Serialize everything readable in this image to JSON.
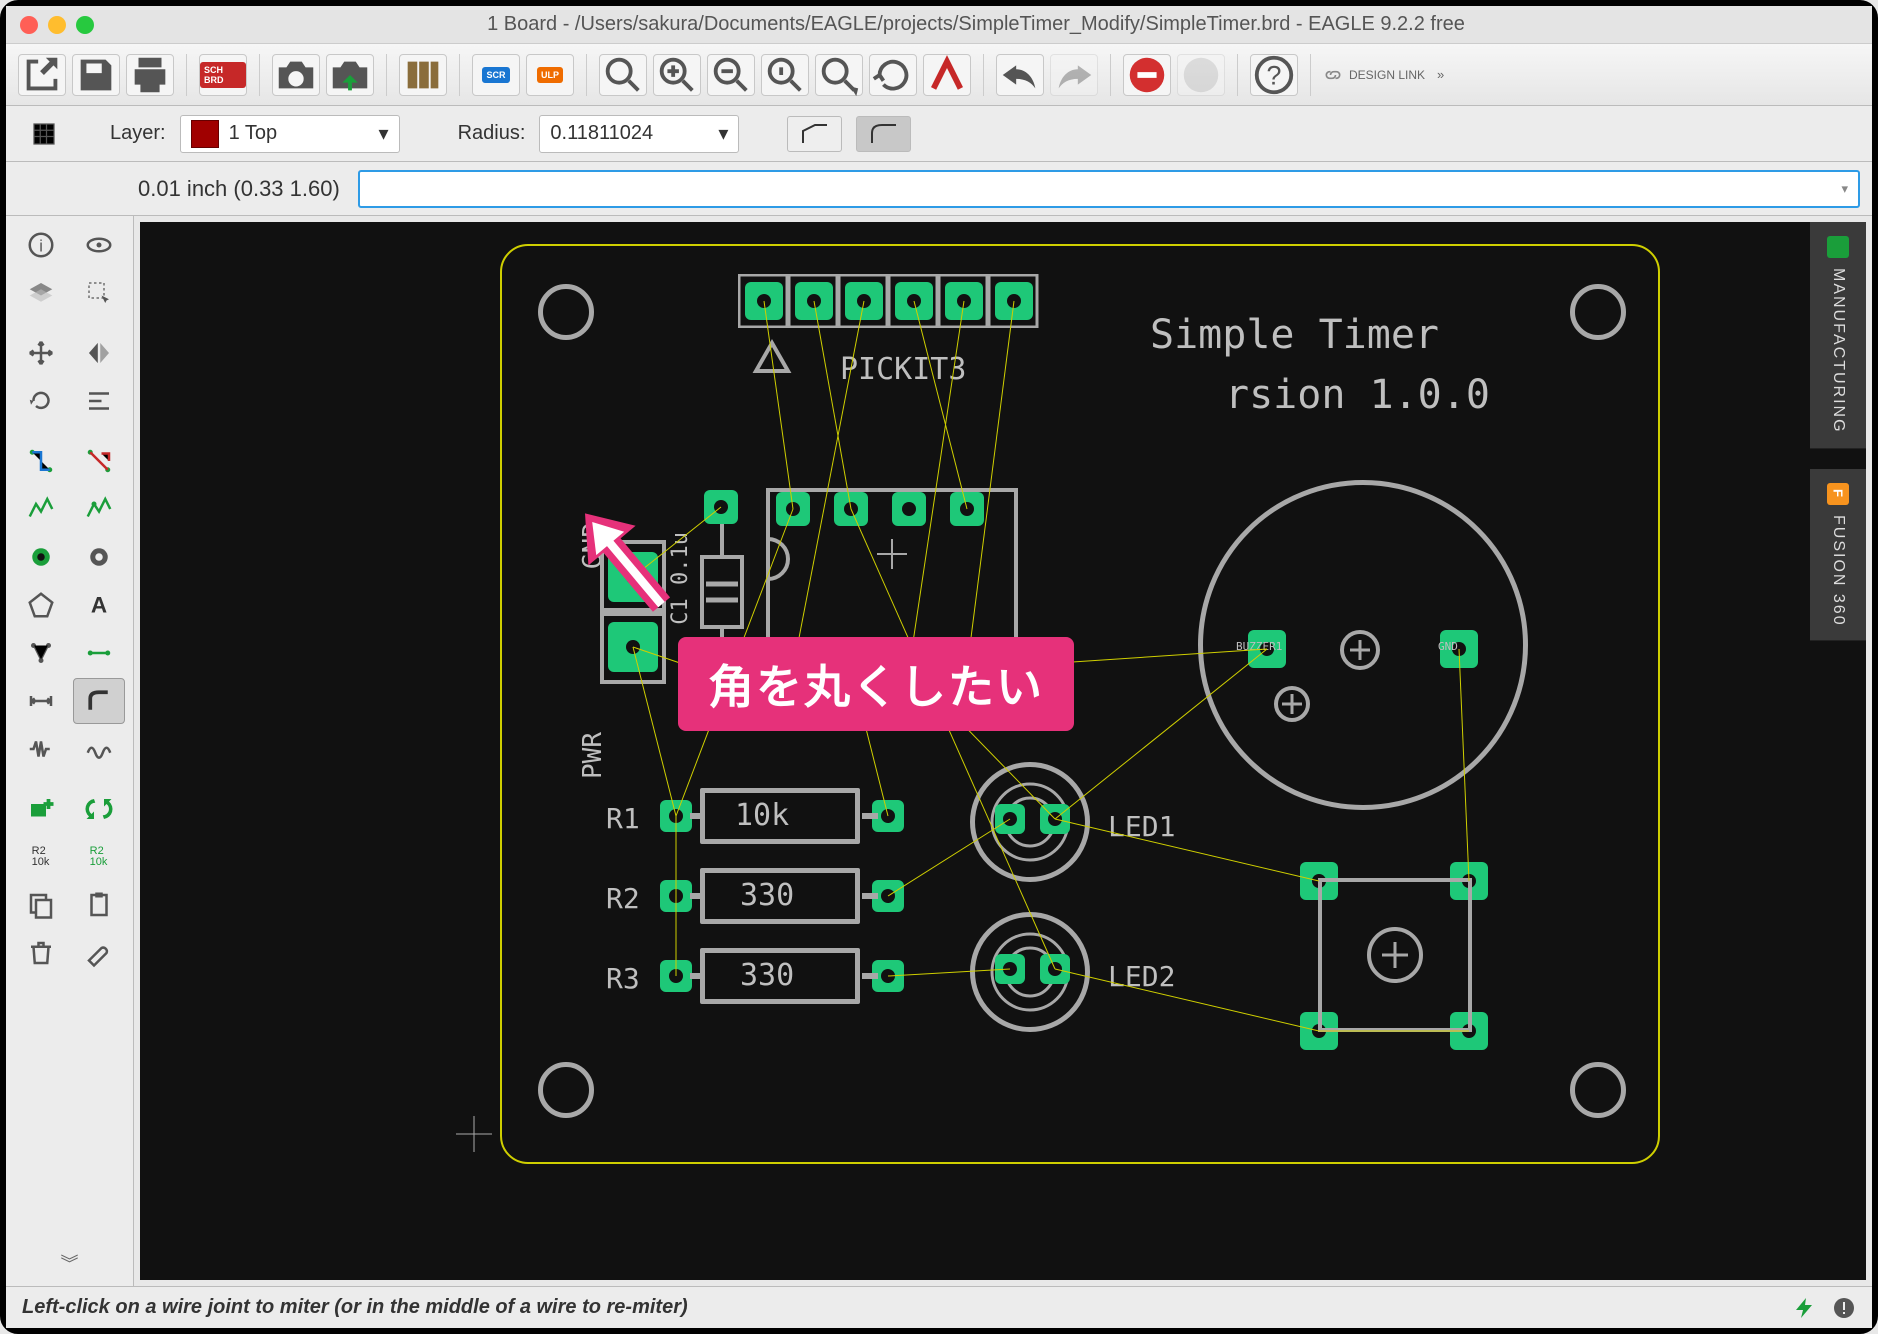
{
  "window": {
    "title": "1 Board - /Users/sakura/Documents/EAGLE/projects/SimpleTimer_Modify/SimpleTimer.brd - EAGLE 9.2.2 free"
  },
  "toolbar": {
    "sch_brd": "SCH\nBRD",
    "scr": "SCR",
    "ulp": "ULP",
    "design_link": "DESIGN LINK"
  },
  "options": {
    "layer_label": "Layer:",
    "layer_value": "1 Top",
    "radius_label": "Radius:",
    "radius_value": "0.11811024"
  },
  "command": {
    "coords": "0.01 inch (0.33 1.60)",
    "input": ""
  },
  "left_tools": {
    "r2_10k": "R2\n10k"
  },
  "board": {
    "title1": "Simple Timer",
    "title2": "rsion 1.0.0",
    "pickit": "PICKIT3",
    "pwr": "PWR",
    "gnd": "GND",
    "c1": "C1 0.1u",
    "r1": "R1",
    "r1_val": "10k",
    "r2": "R2",
    "r2_val": "330",
    "r3": "R3",
    "r3_val": "330",
    "led1": "LED1",
    "led2": "LED2",
    "buzzer1": "BUZZER1",
    "gnd2": "GND"
  },
  "annotation": {
    "callout": "角を丸くしたい"
  },
  "side_tabs": {
    "manufacturing": "MANUFACTURING",
    "fusion": "FUSION 360",
    "fusion_badge": "F"
  },
  "status": {
    "hint": "Left-click on a wire joint to miter (or in the middle of a wire to re-miter)"
  }
}
